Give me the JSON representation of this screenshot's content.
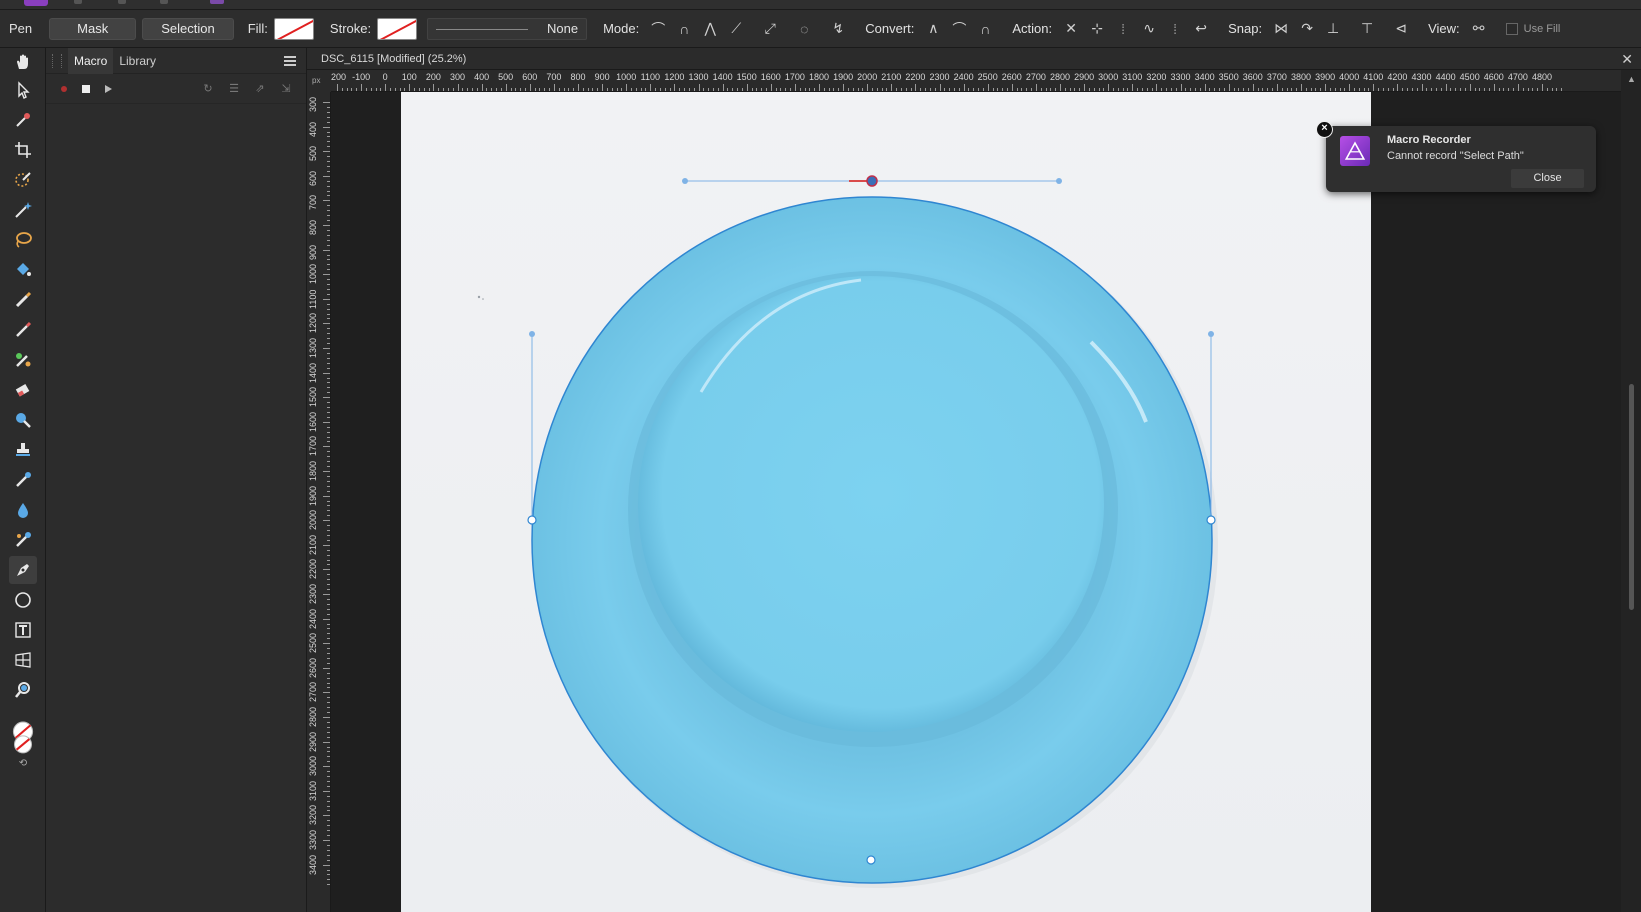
{
  "context_toolbar": {
    "tool_name": "Pen",
    "mask_button": "Mask",
    "selection_button": "Selection",
    "fill_label": "Fill:",
    "stroke_label": "Stroke:",
    "stroke_value": "None",
    "mode_label": "Mode:",
    "convert_label": "Convert:",
    "action_label": "Action:",
    "snap_label": "Snap:",
    "view_label": "View:",
    "use_fill_label": "Use Fill"
  },
  "panel": {
    "tabs": [
      "Macro",
      "Library"
    ],
    "active_tab": "Macro"
  },
  "document": {
    "tab_title": "DSC_6115 [Modified] (25.2%)",
    "ruler_unit": "px",
    "h_ruler_labels": [
      "-200",
      "-100",
      "0",
      "100",
      "200",
      "300",
      "400",
      "500",
      "600",
      "700",
      "800",
      "900",
      "1000",
      "1100",
      "1200",
      "1300",
      "1400",
      "1500",
      "1600",
      "1700",
      "1800",
      "1900",
      "2000",
      "2100",
      "2200",
      "2300",
      "2400",
      "2500",
      "2600",
      "2700",
      "2800",
      "2900",
      "3000",
      "3100",
      "3200",
      "3300",
      "3400",
      "3500",
      "3600",
      "3700",
      "3800",
      "3900",
      "4000",
      "4100",
      "4200",
      "4300",
      "4400",
      "4500",
      "4600",
      "4700",
      "4800"
    ],
    "v_ruler_labels": [
      "300",
      "400",
      "500",
      "600",
      "700",
      "800",
      "900",
      "1000",
      "1100",
      "1200",
      "1300",
      "1400",
      "1500",
      "1600",
      "1700",
      "1800",
      "1900",
      "2000",
      "2100",
      "2200",
      "2300",
      "2400",
      "2500",
      "2600",
      "2700",
      "2800",
      "2900",
      "3000",
      "3100",
      "3200",
      "3300",
      "3400"
    ]
  },
  "toast": {
    "title": "Macro Recorder",
    "message": "Cannot record \"Select Path\"",
    "close_label": "Close"
  },
  "colors": {
    "plate": "#74c9ea",
    "path_stroke": "#2f86d1",
    "accent": "#8a3fbf"
  }
}
